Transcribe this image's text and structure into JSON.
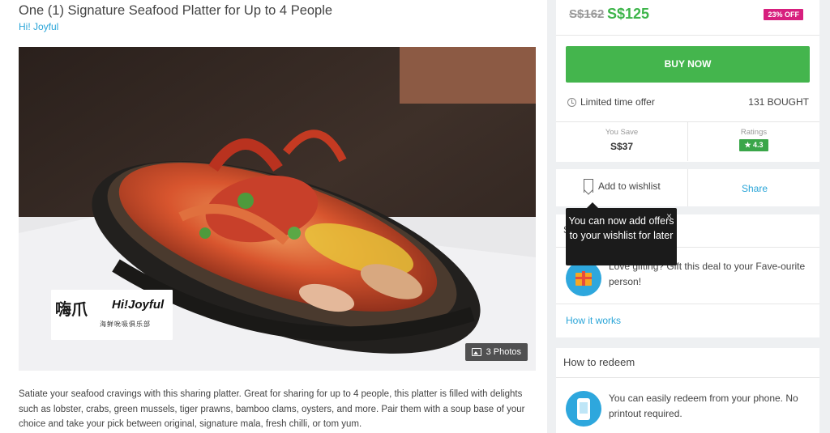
{
  "deal": {
    "title": "One (1) Signature Seafood Platter for Up to 4 People",
    "merchant": "Hi! Joyful",
    "description": "Satiate your seafood cravings with this sharing platter. Great for sharing for up to 4 people, this platter is filled with delights such as lobster, crabs, green mussels, tiger prawns, bamboo clams, oysters, and more. Pair them with a soup base of your choice and take your pick between original, signature mala, fresh chilli, or tom yum."
  },
  "gallery": {
    "photos_label": "3 Photos",
    "logo_left": "嗨爪",
    "logo_right": "Hi!Joyful",
    "logo_sub": "海鲜吮吸俱乐部"
  },
  "pricing": {
    "old_price": "S$162",
    "new_price": "S$125",
    "discount": "23% OFF",
    "buy_label": "BUY NOW",
    "limited_label": "Limited time offer",
    "bought": "131 BOUGHT",
    "save_label": "You Save",
    "save_value": "S$37",
    "ratings_label": "Ratings",
    "rating_value": "★ 4.3"
  },
  "actions": {
    "wishlist_label": "Add to wishlist",
    "share_label": "Share"
  },
  "tooltip": {
    "text": "You can now add offers to your wishlist for later",
    "close": "×"
  },
  "gifting": {
    "header": "S",
    "text": "Love gifting? Gift this deal to your Fave-ourite person!",
    "how_link": "How it works"
  },
  "redeem": {
    "header": "How to redeem",
    "text": "You can easily redeem from your phone. No printout required."
  },
  "colors": {
    "accent_green": "#44b54d",
    "price_green": "#3db54a",
    "discount_pink": "#d71f7e",
    "link_blue": "#2aa5d8"
  },
  "icons": [
    "clock-icon",
    "bookmark-icon",
    "photo-icon",
    "gift-icon",
    "phone-icon",
    "close-icon",
    "star-icon"
  ]
}
